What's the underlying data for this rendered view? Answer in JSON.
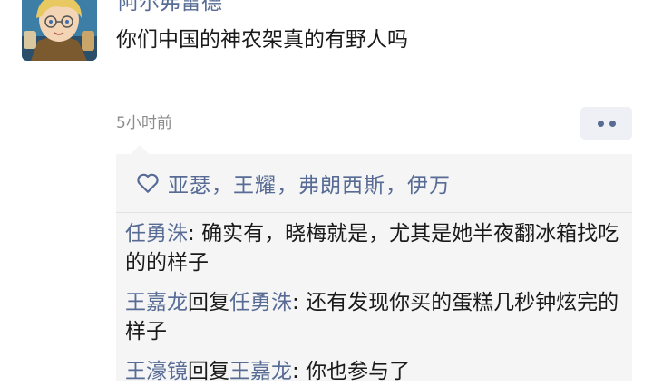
{
  "post": {
    "author": "阿尔弗雷德",
    "text": "你们中国的神农架真的有野人吗",
    "timestamp": "5小时前"
  },
  "likes": {
    "names": "亚瑟，王耀，弗朗西斯，伊万"
  },
  "comments": [
    {
      "user": "任勇洙",
      "reply_word": "",
      "reply_to": "",
      "sep": ": ",
      "text": "确实有，晓梅就是，尤其是她半夜翻冰箱找吃的的样子"
    },
    {
      "user": "王嘉龙",
      "reply_word": "回复",
      "reply_to": "任勇洙",
      "sep": ": ",
      "text": "还有发现你买的蛋糕几秒钟炫完的样子"
    },
    {
      "user": "王濠镜",
      "reply_word": "回复",
      "reply_to": "王嘉龙",
      "sep": ": ",
      "text": "你也参与了"
    }
  ],
  "colors": {
    "link": "#576b95",
    "text": "#1a1a1a",
    "muted": "#8c8c8c",
    "comment_bg": "#f5f5f5"
  },
  "icons": {
    "avatar": "anime-character-avatar",
    "more": "more-dots-icon",
    "like": "heart-outline-icon"
  }
}
